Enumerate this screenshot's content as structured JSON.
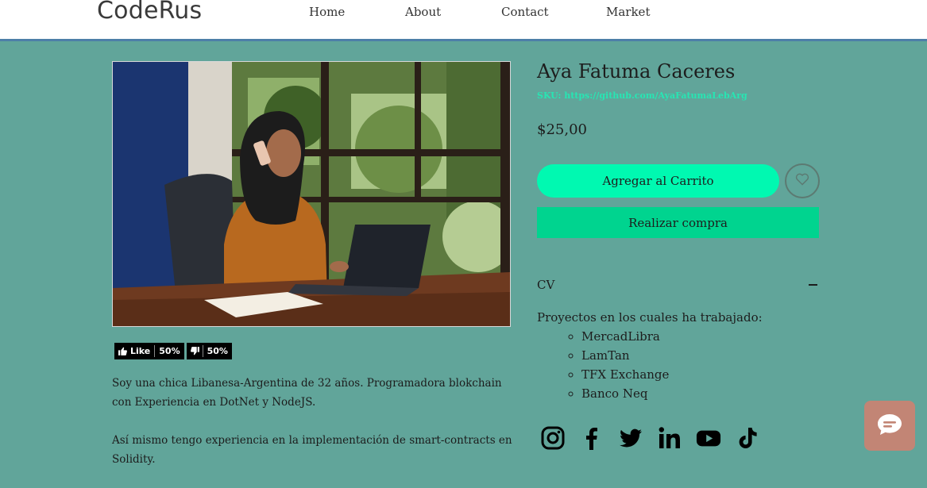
{
  "header": {
    "logo": "CodeRus",
    "nav": [
      {
        "label": "Home"
      },
      {
        "label": "About"
      },
      {
        "label": "Contact"
      },
      {
        "label": "Market"
      }
    ]
  },
  "product": {
    "title": "Aya Fatuma Caceres",
    "sku": "SKU: https://github.com/AyaFatumaLebArg",
    "price": "$25,00",
    "add_to_cart": "Agregar al Carrito",
    "buy_now": "Realizar compra",
    "image_icon": "photo-woman-laptop-phone"
  },
  "rating": {
    "like_label": "Like",
    "like_pct": "50%",
    "dislike_pct": "50%"
  },
  "description": {
    "paragraphs": [
      "Soy una chica Libanesa-Argentina de 32 años. Programadora blokchain con Experiencia en DotNet y NodeJS.",
      "Así mismo tengo experiencia en la implementación de smart-contracts en Solidity."
    ]
  },
  "cv": {
    "header": "CV",
    "intro": "Proyectos en los cuales ha trabajado:",
    "projects": [
      "MercadLibra",
      "LamTan",
      "TFX Exchange",
      "Banco Neq"
    ]
  },
  "social": [
    "instagram-icon",
    "facebook-icon",
    "twitter-icon",
    "linkedin-icon",
    "youtube-icon",
    "tiktok-icon"
  ],
  "colors": {
    "page_bg": "#61a59a",
    "cart_button": "#00f9b1",
    "buy_button": "#00d48f",
    "sku_link": "#27e6b3",
    "chat_button": "#c28575",
    "header_border": "#4d7fa8"
  }
}
